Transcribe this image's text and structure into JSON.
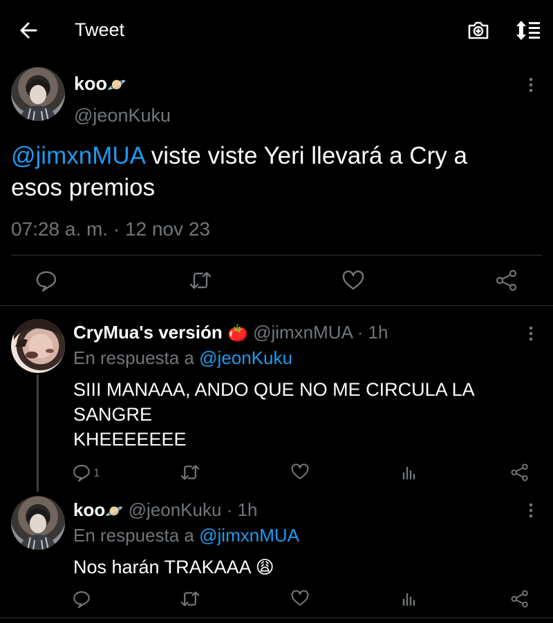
{
  "header": {
    "title": "Tweet",
    "back_icon": "arrow-left-icon",
    "camera_icon": "camera-add-icon",
    "sort_icon": "sort-lines-icon"
  },
  "main_tweet": {
    "display_name": "koo",
    "name_emoji": "🪐",
    "handle": "@jeonKuku",
    "mention": "@jimxnMUA",
    "text_line1": " viste viste Yeri llevará a Cry a",
    "text_line2": "esos premios",
    "timestamp": "07:28 a. m. · 12 nov 23"
  },
  "replies": [
    {
      "display_name": "CryMua's versión",
      "name_emoji": "🍅",
      "handle": "@jimxnMUA",
      "time": "· 1h",
      "reply_prefix": "En respuesta a ",
      "reply_to": "@jeonKuku",
      "text_lines": [
        "SIII MANAAA, ANDO QUE NO ME CIRCULA LA",
        "SANGRE",
        "KHEEEEEEE"
      ],
      "reply_count": "1"
    },
    {
      "display_name": "koo",
      "name_emoji": "🪐",
      "handle": "@jeonKuku",
      "time": "· 1h",
      "reply_prefix": "En respuesta a ",
      "reply_to": "@jimxnMUA",
      "text": "Nos harán TRAKAAA ",
      "text_emoji": "😩"
    }
  ],
  "colors": {
    "background": "#000000",
    "accent": "#1d9bf0",
    "muted": "#71767b",
    "divider": "#2f3336"
  }
}
